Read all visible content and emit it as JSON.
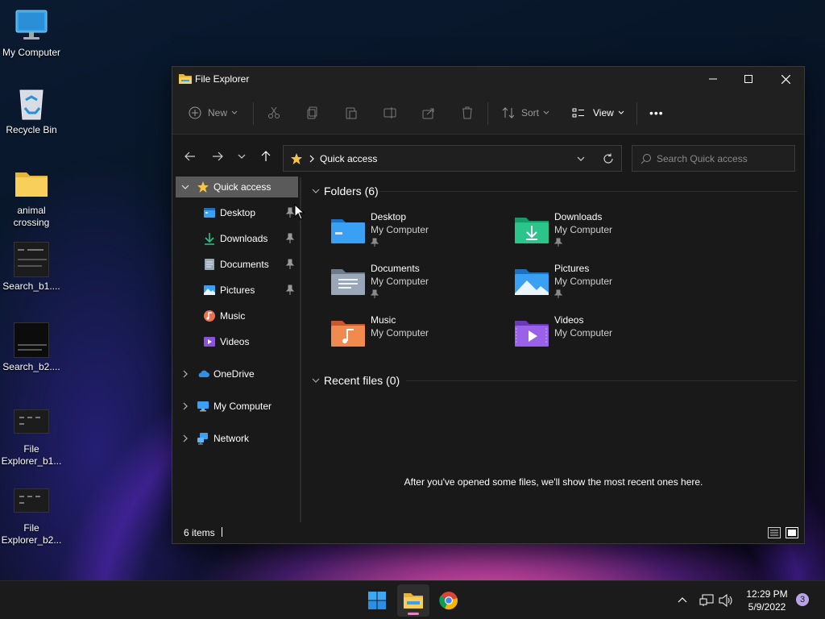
{
  "desktop": {
    "icons": [
      {
        "label": "My Computer",
        "icon": "monitor-icon"
      },
      {
        "label": "Recycle Bin",
        "icon": "recycle-bin-icon"
      },
      {
        "label": "animal\ncrossing",
        "icon": "folder-icon"
      },
      {
        "label": "Search_b1....",
        "icon": "screenshot-thumbnail-icon"
      },
      {
        "label": "Search_b2....",
        "icon": "screenshot-thumbnail-icon"
      },
      {
        "label": "File\nExplorer_b1...",
        "icon": "screenshot-thumbnail-icon"
      },
      {
        "label": "File\nExplorer_b2...",
        "icon": "screenshot-thumbnail-icon"
      }
    ]
  },
  "window": {
    "title": "File Explorer",
    "controls": {
      "minimize": "minimize-icon",
      "maximize": "maximize-icon",
      "close": "close-icon"
    }
  },
  "commandbar": {
    "new_label": "New",
    "sort_label": "Sort",
    "view_label": "View",
    "more_label": "•••",
    "icons": [
      "cut-icon",
      "copy-icon",
      "paste-icon",
      "rename-icon",
      "share-icon",
      "delete-icon"
    ]
  },
  "navigation": {
    "address_crumb": "Quick access",
    "search_placeholder": "Search Quick access"
  },
  "sidebar": {
    "quick_access": "Quick access",
    "pinned": [
      {
        "label": "Desktop",
        "pinned": true
      },
      {
        "label": "Downloads",
        "pinned": true
      },
      {
        "label": "Documents",
        "pinned": true
      },
      {
        "label": "Pictures",
        "pinned": true
      },
      {
        "label": "Music",
        "pinned": false
      },
      {
        "label": "Videos",
        "pinned": false
      }
    ],
    "roots": [
      {
        "label": "OneDrive"
      },
      {
        "label": "My Computer"
      },
      {
        "label": "Network"
      }
    ]
  },
  "content": {
    "folders_header": "Folders (6)",
    "folders": [
      {
        "name": "Desktop",
        "location": "My Computer",
        "pinned": true
      },
      {
        "name": "Downloads",
        "location": "My Computer",
        "pinned": true
      },
      {
        "name": "Documents",
        "location": "My Computer",
        "pinned": true
      },
      {
        "name": "Pictures",
        "location": "My Computer",
        "pinned": true
      },
      {
        "name": "Music",
        "location": "My Computer",
        "pinned": false
      },
      {
        "name": "Videos",
        "location": "My Computer",
        "pinned": false
      }
    ],
    "recent_header": "Recent files (0)",
    "recent_empty": "After you've opened some files, we'll show the most recent ones here."
  },
  "statusbar": {
    "item_count": "6 items"
  },
  "taskbar": {
    "apps": [
      "start-icon",
      "file-explorer-icon",
      "chrome-icon"
    ],
    "time": "12:29 PM",
    "date": "5/9/2022",
    "notifications": "3"
  },
  "colors": {
    "window_bg": "#191919",
    "selected_bg": "#5a5a5a",
    "folder_yellow": "#f4c542",
    "accent_blue": "#3aa0f3"
  }
}
